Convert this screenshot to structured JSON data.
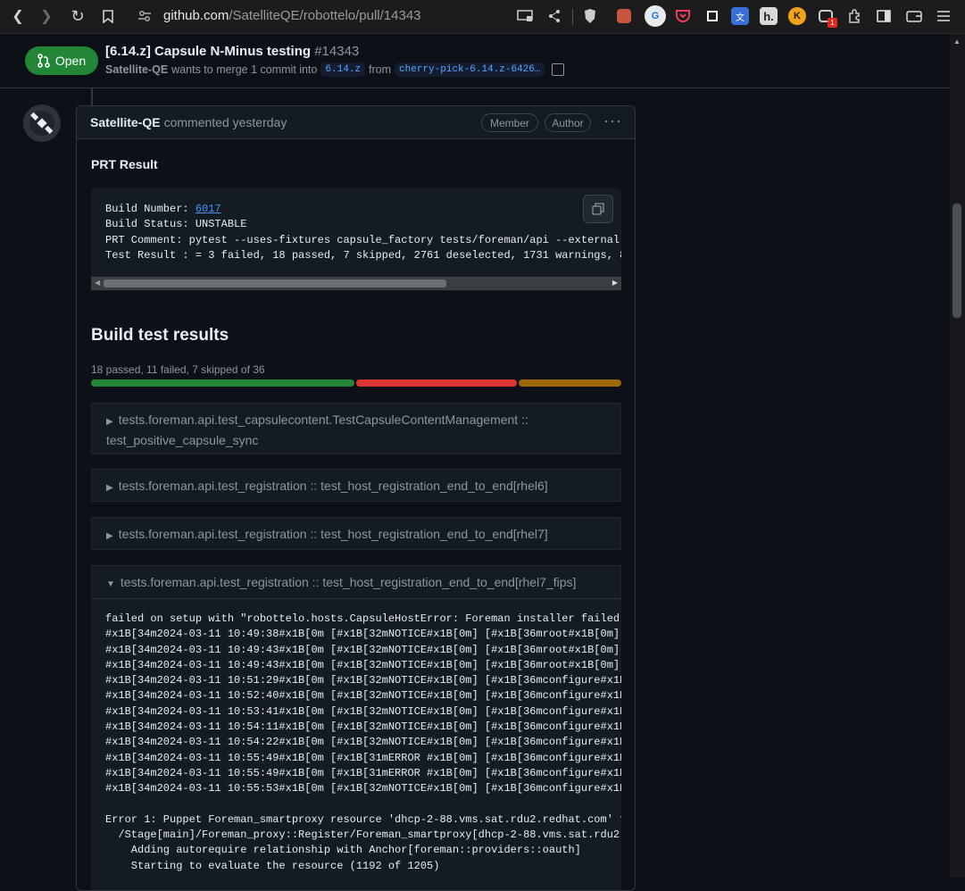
{
  "browser": {
    "url_host": "github.com",
    "url_path": "/SatelliteQE/robottelo/pull/14343",
    "extension_badge": "1",
    "extensions": [
      "cast-icon",
      "share-icon",
      "brave-shield-icon",
      "gift-icon",
      "translate-icon",
      "pocket-icon",
      "square-icon",
      "translate2-icon",
      "h-icon",
      "k-icon",
      "octo-icon",
      "puzzle-icon",
      "sidebar-icon",
      "wallet-icon",
      "menu-icon"
    ]
  },
  "pr": {
    "state": "Open",
    "title": "[6.14.z] Capsule N-Minus testing",
    "number": "#14343",
    "author": "Satellite-QE",
    "merge_text": "wants to merge 1 commit into",
    "base_branch": "6.14.z",
    "from_text": "from",
    "head_branch": "cherry-pick-6.14.z-6426…"
  },
  "comment": {
    "author": "Satellite-QE",
    "meta": "commented yesterday",
    "badges": [
      "Member",
      "Author"
    ],
    "heading": "PRT Result",
    "build_label": "Build Number: ",
    "build_number": "6017",
    "build_status": "Build Status: UNSTABLE",
    "prt_comment": "PRT Comment: pytest --uses-fixtures capsule_factory tests/foreman/api --external-",
    "test_result": "Test Result : = 3 failed, 18 passed, 7 skipped, 2761 deselected, 1731 warnings, 8",
    "results_heading": "Build test results",
    "summary": "18 passed, 11 failed, 7 skipped of 36",
    "progress": {
      "passed": 18,
      "failed": 11,
      "skipped": 7,
      "total": 36,
      "colors": {
        "passed": "#238636",
        "failed": "#da3633",
        "skipped": "#9e6a03"
      }
    },
    "tests": [
      {
        "line1": "tests.foreman.api.test_capsulecontent.TestCapsuleContentManagement ::",
        "line2": "test_positive_capsule_sync",
        "open": false
      },
      {
        "line1": "tests.foreman.api.test_registration :: test_host_registration_end_to_end[rhel6]",
        "open": false
      },
      {
        "line1": "tests.foreman.api.test_registration :: test_host_registration_end_to_end[rhel7]",
        "open": false
      },
      {
        "line1": "tests.foreman.api.test_registration :: test_host_registration_end_to_end[rhel7_fips]",
        "open": true
      }
    ],
    "log_lines": [
      "failed on setup with \"robottelo.hosts.CapsuleHostError: Foreman installer failed",
      "#x1B[34m2024-03-11 10:49:38#x1B[0m [#x1B[32mNOTICE#x1B[0m] [#x1B[36mroot#x1B[0m]",
      "#x1B[34m2024-03-11 10:49:43#x1B[0m [#x1B[32mNOTICE#x1B[0m] [#x1B[36mroot#x1B[0m]",
      "#x1B[34m2024-03-11 10:49:43#x1B[0m [#x1B[32mNOTICE#x1B[0m] [#x1B[36mroot#x1B[0m]",
      "#x1B[34m2024-03-11 10:51:29#x1B[0m [#x1B[32mNOTICE#x1B[0m] [#x1B[36mconfigure#x1B",
      "#x1B[34m2024-03-11 10:52:40#x1B[0m [#x1B[32mNOTICE#x1B[0m] [#x1B[36mconfigure#x1B",
      "#x1B[34m2024-03-11 10:53:41#x1B[0m [#x1B[32mNOTICE#x1B[0m] [#x1B[36mconfigure#x1B",
      "#x1B[34m2024-03-11 10:54:11#x1B[0m [#x1B[32mNOTICE#x1B[0m] [#x1B[36mconfigure#x1B",
      "#x1B[34m2024-03-11 10:54:22#x1B[0m [#x1B[32mNOTICE#x1B[0m] [#x1B[36mconfigure#x1B",
      "#x1B[34m2024-03-11 10:55:49#x1B[0m [#x1B[31mERROR #x1B[0m] [#x1B[36mconfigure#x1B",
      "#x1B[34m2024-03-11 10:55:49#x1B[0m [#x1B[31mERROR #x1B[0m] [#x1B[36mconfigure#x1B",
      "#x1B[34m2024-03-11 10:55:53#x1B[0m [#x1B[32mNOTICE#x1B[0m] [#x1B[36mconfigure#x1B",
      "",
      "Error 1: Puppet Foreman_smartproxy resource 'dhcp-2-88.vms.sat.rdu2.redhat.com' f",
      "  /Stage[main]/Foreman_proxy::Register/Foreman_smartproxy[dhcp-2-88.vms.sat.rdu2.",
      "    Adding autorequire relationship with Anchor[foreman::providers::oauth]",
      "    Starting to evaluate the resource (1192 of 1205)"
    ]
  }
}
